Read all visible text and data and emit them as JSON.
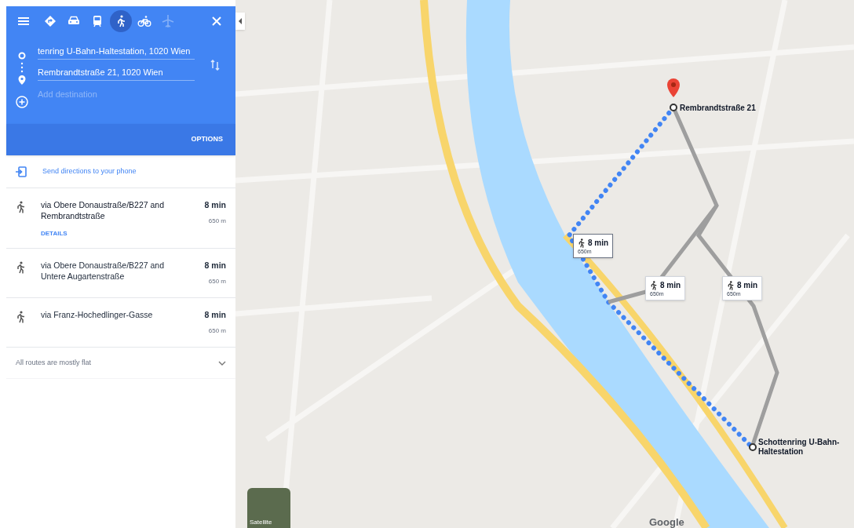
{
  "modes": [
    {
      "kind": "menu",
      "selected": false,
      "disabled": false
    },
    {
      "kind": "best",
      "selected": false,
      "disabled": false
    },
    {
      "kind": "car",
      "selected": false,
      "disabled": false
    },
    {
      "kind": "transit",
      "selected": false,
      "disabled": false
    },
    {
      "kind": "walk",
      "selected": true,
      "disabled": false
    },
    {
      "kind": "bike",
      "selected": false,
      "disabled": false
    },
    {
      "kind": "flight",
      "selected": false,
      "disabled": true
    }
  ],
  "origin": {
    "value": "tenring U-Bahn-Haltestation, 1020 Wien"
  },
  "destination": {
    "value": "Rembrandtstraße 21, 1020 Wien"
  },
  "add_destination": {
    "placeholder": "Add destination"
  },
  "options": "OPTIONS",
  "send_directions": "Send directions to your phone",
  "routes": [
    {
      "via": "via Obere Donaustraße/B227 and Rembrandtstraße",
      "time": "8 min",
      "distance": "650 m",
      "selected": true,
      "details": "DETAILS"
    },
    {
      "via": "via Obere Donaustraße/B227 and Untere Augartenstraße",
      "time": "8 min",
      "distance": "650 m",
      "selected": false
    },
    {
      "via": "via Franz-Hochedlinger-Gasse",
      "time": "8 min",
      "distance": "650 m",
      "selected": false
    }
  ],
  "footer": "All routes are mostly flat",
  "map": {
    "callouts": [
      {
        "time": "8 min",
        "distance": "650m",
        "selected": true
      },
      {
        "time": "8 min",
        "distance": "650m",
        "selected": false
      },
      {
        "time": "8 min",
        "distance": "650m",
        "selected": false
      }
    ],
    "end_label": "Rembrandtstraße 21",
    "start_label": "Schottenring U-Bahn-Haltestation",
    "satellite": "Satellite",
    "logo": "Google"
  }
}
